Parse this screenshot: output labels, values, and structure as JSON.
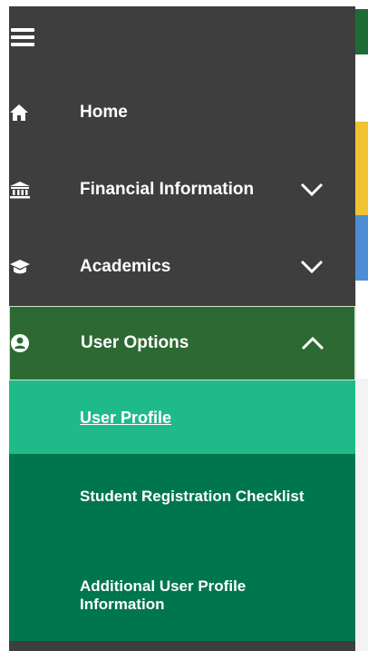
{
  "sidebar": {
    "menu_icon": "hamburger-menu-icon",
    "items": [
      {
        "label": "Home",
        "icon": "home-icon",
        "chevron": "none"
      },
      {
        "label": "Financial Information",
        "icon": "bank-icon",
        "chevron": "chevron-down-icon"
      },
      {
        "label": "Academics",
        "icon": "graduation-cap-icon",
        "chevron": "chevron-down-icon"
      },
      {
        "label": "User Options",
        "icon": "user-circle-icon",
        "chevron": "chevron-up-icon",
        "expanded": true
      }
    ],
    "submenu": [
      {
        "label": "User Profile",
        "active": true
      },
      {
        "label": "Student Registration Checklist",
        "active": false
      },
      {
        "label": "Additional User Profile Information",
        "active": false
      }
    ]
  },
  "colors": {
    "sidebar_bg": "#3e3e3e",
    "expanded_item_bg": "#2d6a33",
    "submenu_bg": "#00764f",
    "active_submenu_bg": "#1fba8a",
    "text": "#ffffff"
  }
}
